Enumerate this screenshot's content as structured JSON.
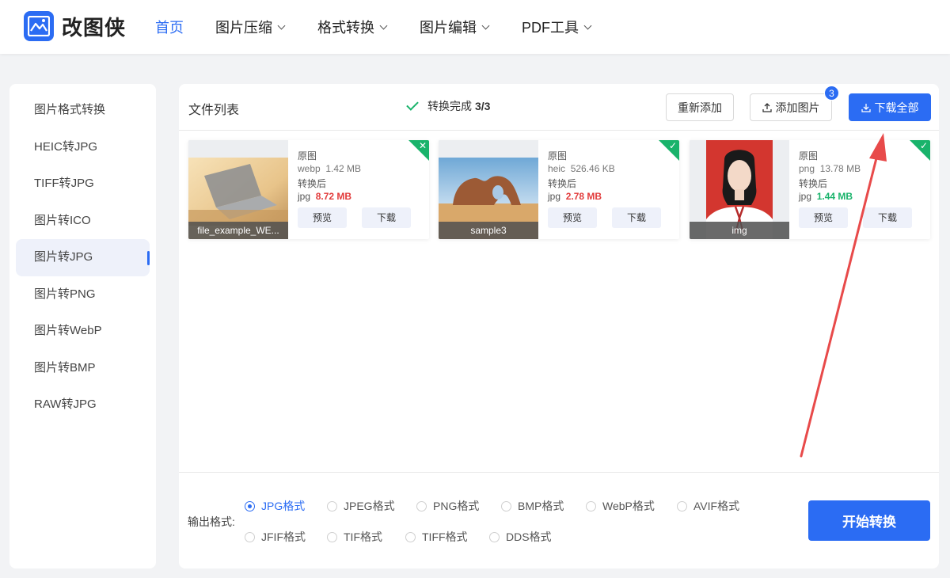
{
  "brand": {
    "name": "改图侠",
    "color": "#2b6cf3"
  },
  "nav": [
    {
      "label": "首页",
      "active": true,
      "dropdown": false
    },
    {
      "label": "图片压缩",
      "dropdown": true
    },
    {
      "label": "格式转换",
      "dropdown": true
    },
    {
      "label": "图片编辑",
      "dropdown": true
    },
    {
      "label": "PDF工具",
      "dropdown": true
    }
  ],
  "sidebar": {
    "items": [
      {
        "label": "图片格式转换"
      },
      {
        "label": "HEIC转JPG"
      },
      {
        "label": "TIFF转JPG"
      },
      {
        "label": "图片转ICO"
      },
      {
        "label": "图片转JPG",
        "active": true
      },
      {
        "label": "图片转PNG"
      },
      {
        "label": "图片转WebP"
      },
      {
        "label": "图片转BMP"
      },
      {
        "label": "RAW转JPG"
      }
    ]
  },
  "toolbar": {
    "title": "文件列表",
    "status_text": "转换完成",
    "status_count": "3/3",
    "readd_label": "重新添加",
    "add_label": "添加图片",
    "add_badge": "3",
    "download_all_label": "下载全部"
  },
  "files": [
    {
      "name": "file_example_WE...",
      "orig_label": "原图",
      "orig_format": "webp",
      "orig_size": "1.42 MB",
      "after_label": "转换后",
      "new_format": "jpg",
      "new_size": "8.72 MB",
      "size_status": "larger",
      "preview_label": "预览",
      "download_label": "下载",
      "corner_icon": "close-icon"
    },
    {
      "name": "sample3",
      "orig_label": "原图",
      "orig_format": "heic",
      "orig_size": "526.46 KB",
      "after_label": "转换后",
      "new_format": "jpg",
      "new_size": "2.78 MB",
      "size_status": "larger",
      "preview_label": "预览",
      "download_label": "下载",
      "corner_icon": "check-icon"
    },
    {
      "name": "img",
      "orig_label": "原图",
      "orig_format": "png",
      "orig_size": "13.78 MB",
      "after_label": "转换后",
      "new_format": "jpg",
      "new_size": "1.44 MB",
      "size_status": "smaller",
      "preview_label": "预览",
      "download_label": "下载",
      "corner_icon": "check-icon"
    }
  ],
  "output": {
    "label": "输出格式:",
    "selected": "JPG格式",
    "formats": [
      "JPG格式",
      "JPEG格式",
      "PNG格式",
      "BMP格式",
      "WebP格式",
      "AVIF格式",
      "JFIF格式",
      "TIF格式",
      "TIFF格式",
      "DDS格式"
    ]
  },
  "start_label": "开始转换",
  "colors": {
    "accent": "#2b6cf3",
    "success": "#19b36b",
    "danger": "#e23b3b",
    "annotation_arrow": "#e84a4a"
  }
}
